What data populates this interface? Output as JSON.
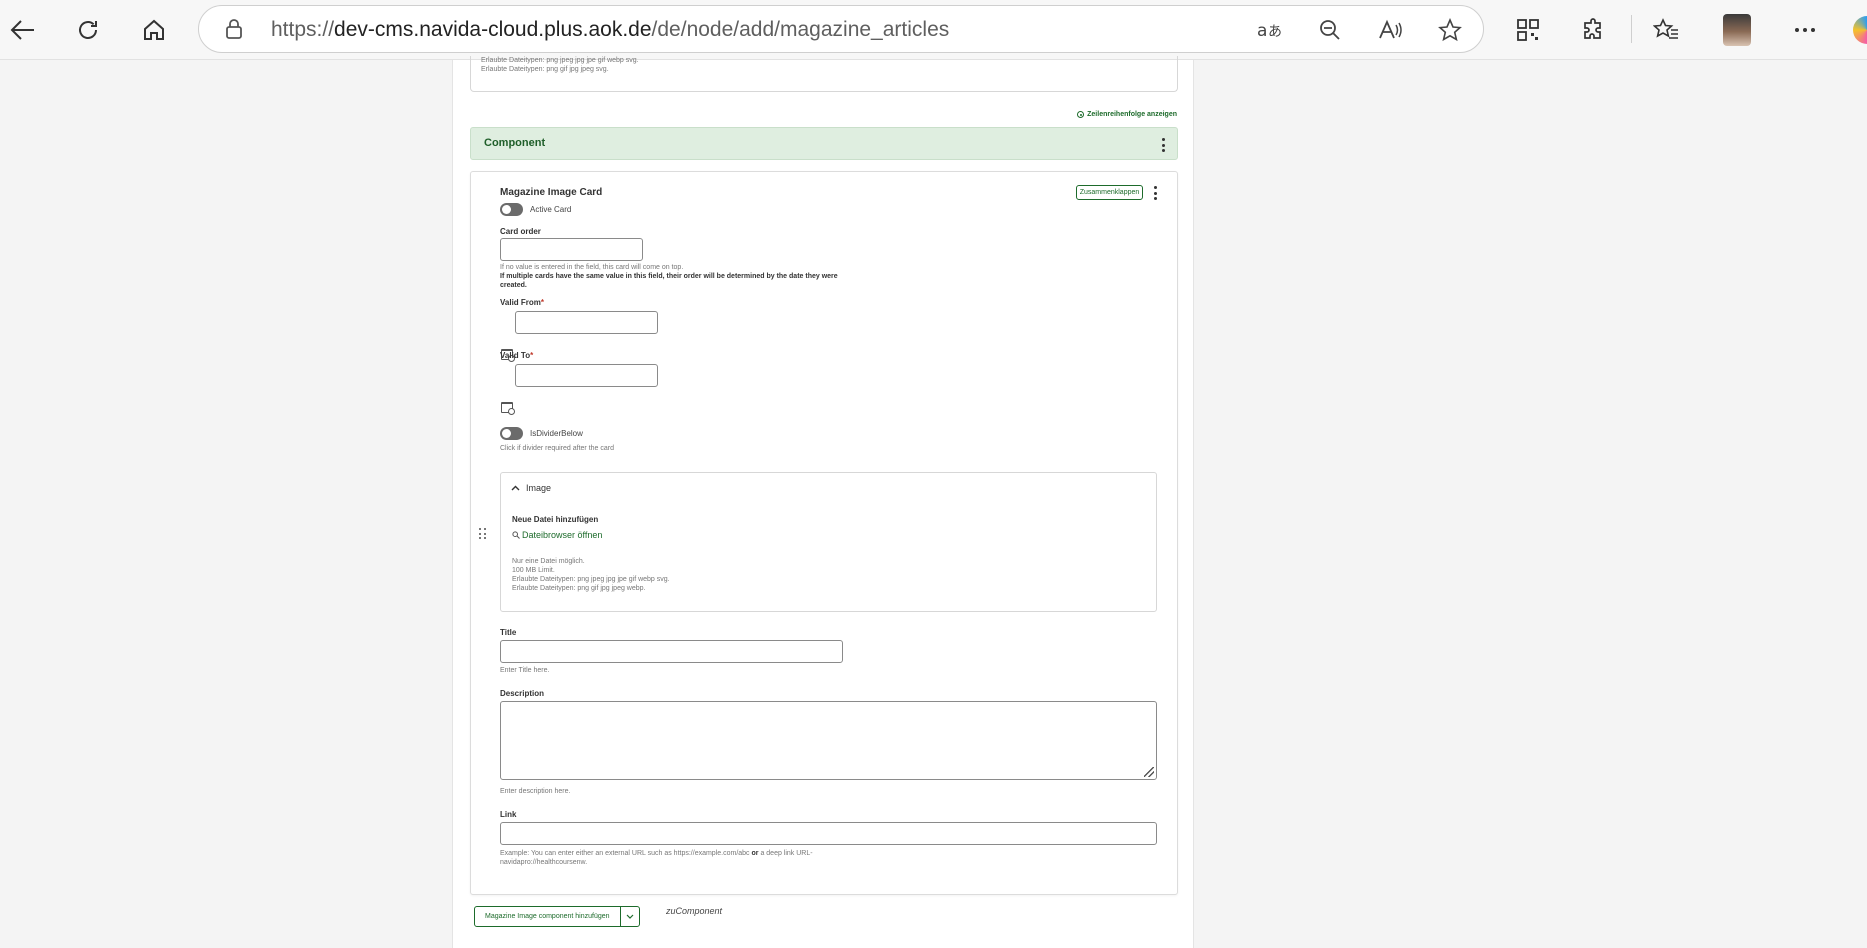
{
  "browser": {
    "url_prefix": "https://",
    "url_host": "dev-cms.navida-cloud.plus.aok.de",
    "url_path": "/de/node/add/magazine_articles"
  },
  "top_box": {
    "line1": "Erlaubte Dateitypen: png jpeg jpg jpe gif webp svg.",
    "line2": "Erlaubte Dateitypen: png gif jpg jpeg svg."
  },
  "order_link": "Zeilenreihenfolge anzeigen",
  "component": {
    "title": "Component"
  },
  "card": {
    "title": "Magazine Image Card",
    "collapse_label": "Zusammenklappen",
    "active_card_label": "Active Card",
    "card_order_label": "Card order",
    "card_order_help1": "If no value is entered in the field, this card will come on top.",
    "card_order_help2": "If multiple cards have the same value in this field, their order will be determined by the date they were",
    "card_order_help3": "created.",
    "valid_from_label": "Valid From",
    "valid_to_label": "Valid To",
    "required_mark": "*",
    "divider_label": "IsDividerBelow",
    "divider_help": "Click if divider required after the card",
    "image": {
      "title": "Image",
      "add_label": "Neue Datei hinzufügen",
      "browser_link": "Dateibrowser öffnen",
      "help1": "Nur eine Datei möglich.",
      "help2": "100 MB Limit.",
      "help3": "Erlaubte Dateitypen: png jpeg jpg jpe gif webp svg.",
      "help4": "Erlaubte Dateitypen: png gif jpg jpeg webp."
    },
    "title_label": "Title",
    "title_help": "Enter Title here.",
    "description_label": "Description",
    "description_help": "Enter description here.",
    "link_label": "Link",
    "link_help1_a": "Example: You can enter either an external URL such as https://example.com/abc ",
    "link_help1_b": "or",
    "link_help1_c": " a deep link URL-",
    "link_help2": "navidapro://healthcoursenw."
  },
  "add_button_label": "Magazine Image component hinzufügen",
  "zu_label": "zuComponent",
  "accent_color": "#1d6b2b",
  "component_bar_color": "#dfeee0"
}
